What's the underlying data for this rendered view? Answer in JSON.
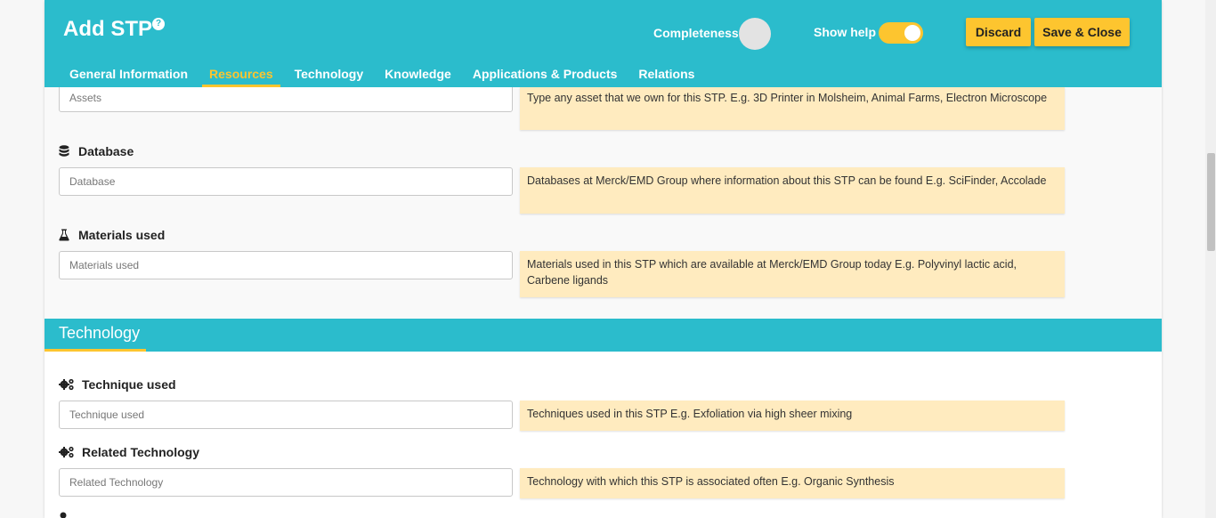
{
  "header": {
    "title": "Add STP",
    "completeness_label": "Completeness",
    "show_help_label": "Show help",
    "discard_label": "Discard",
    "save_label": "Save & Close",
    "accent_color": "#2bbccc",
    "highlight_color": "#fdc52f"
  },
  "tabs": [
    {
      "label": "General Information"
    },
    {
      "label": "Resources"
    },
    {
      "label": "Technology"
    },
    {
      "label": "Knowledge"
    },
    {
      "label": "Applications & Products"
    },
    {
      "label": "Relations"
    }
  ],
  "fields": {
    "assets": {
      "placeholder": "Assets",
      "hint": "Type any asset that we own for this STP. E.g. 3D Printer in Molsheim, Animal Farms, Electron Microscope"
    },
    "database": {
      "label": "Database",
      "icon": "database-icon",
      "placeholder": "Database",
      "hint": "Databases at Merck/EMD Group where information about this STP can be found E.g. SciFinder, Accolade"
    },
    "materials": {
      "label": "Materials used",
      "icon": "flask-icon",
      "placeholder": "Materials used",
      "hint": "Materials used in this STP which are available at Merck/EMD Group today E.g. Polyvinyl lactic acid, Carbene ligands"
    },
    "technique": {
      "label": "Technique used",
      "icon": "gears-icon",
      "placeholder": "Technique used",
      "hint": "Techniques used in this STP E.g. Exfoliation via high sheer mixing"
    },
    "related_technology": {
      "label": "Related Technology",
      "icon": "gears-icon",
      "placeholder": "Related Technology",
      "hint": "Technology with which this STP is associated often E.g. Organic Synthesis"
    }
  },
  "technology_section": {
    "title": "Technology"
  }
}
